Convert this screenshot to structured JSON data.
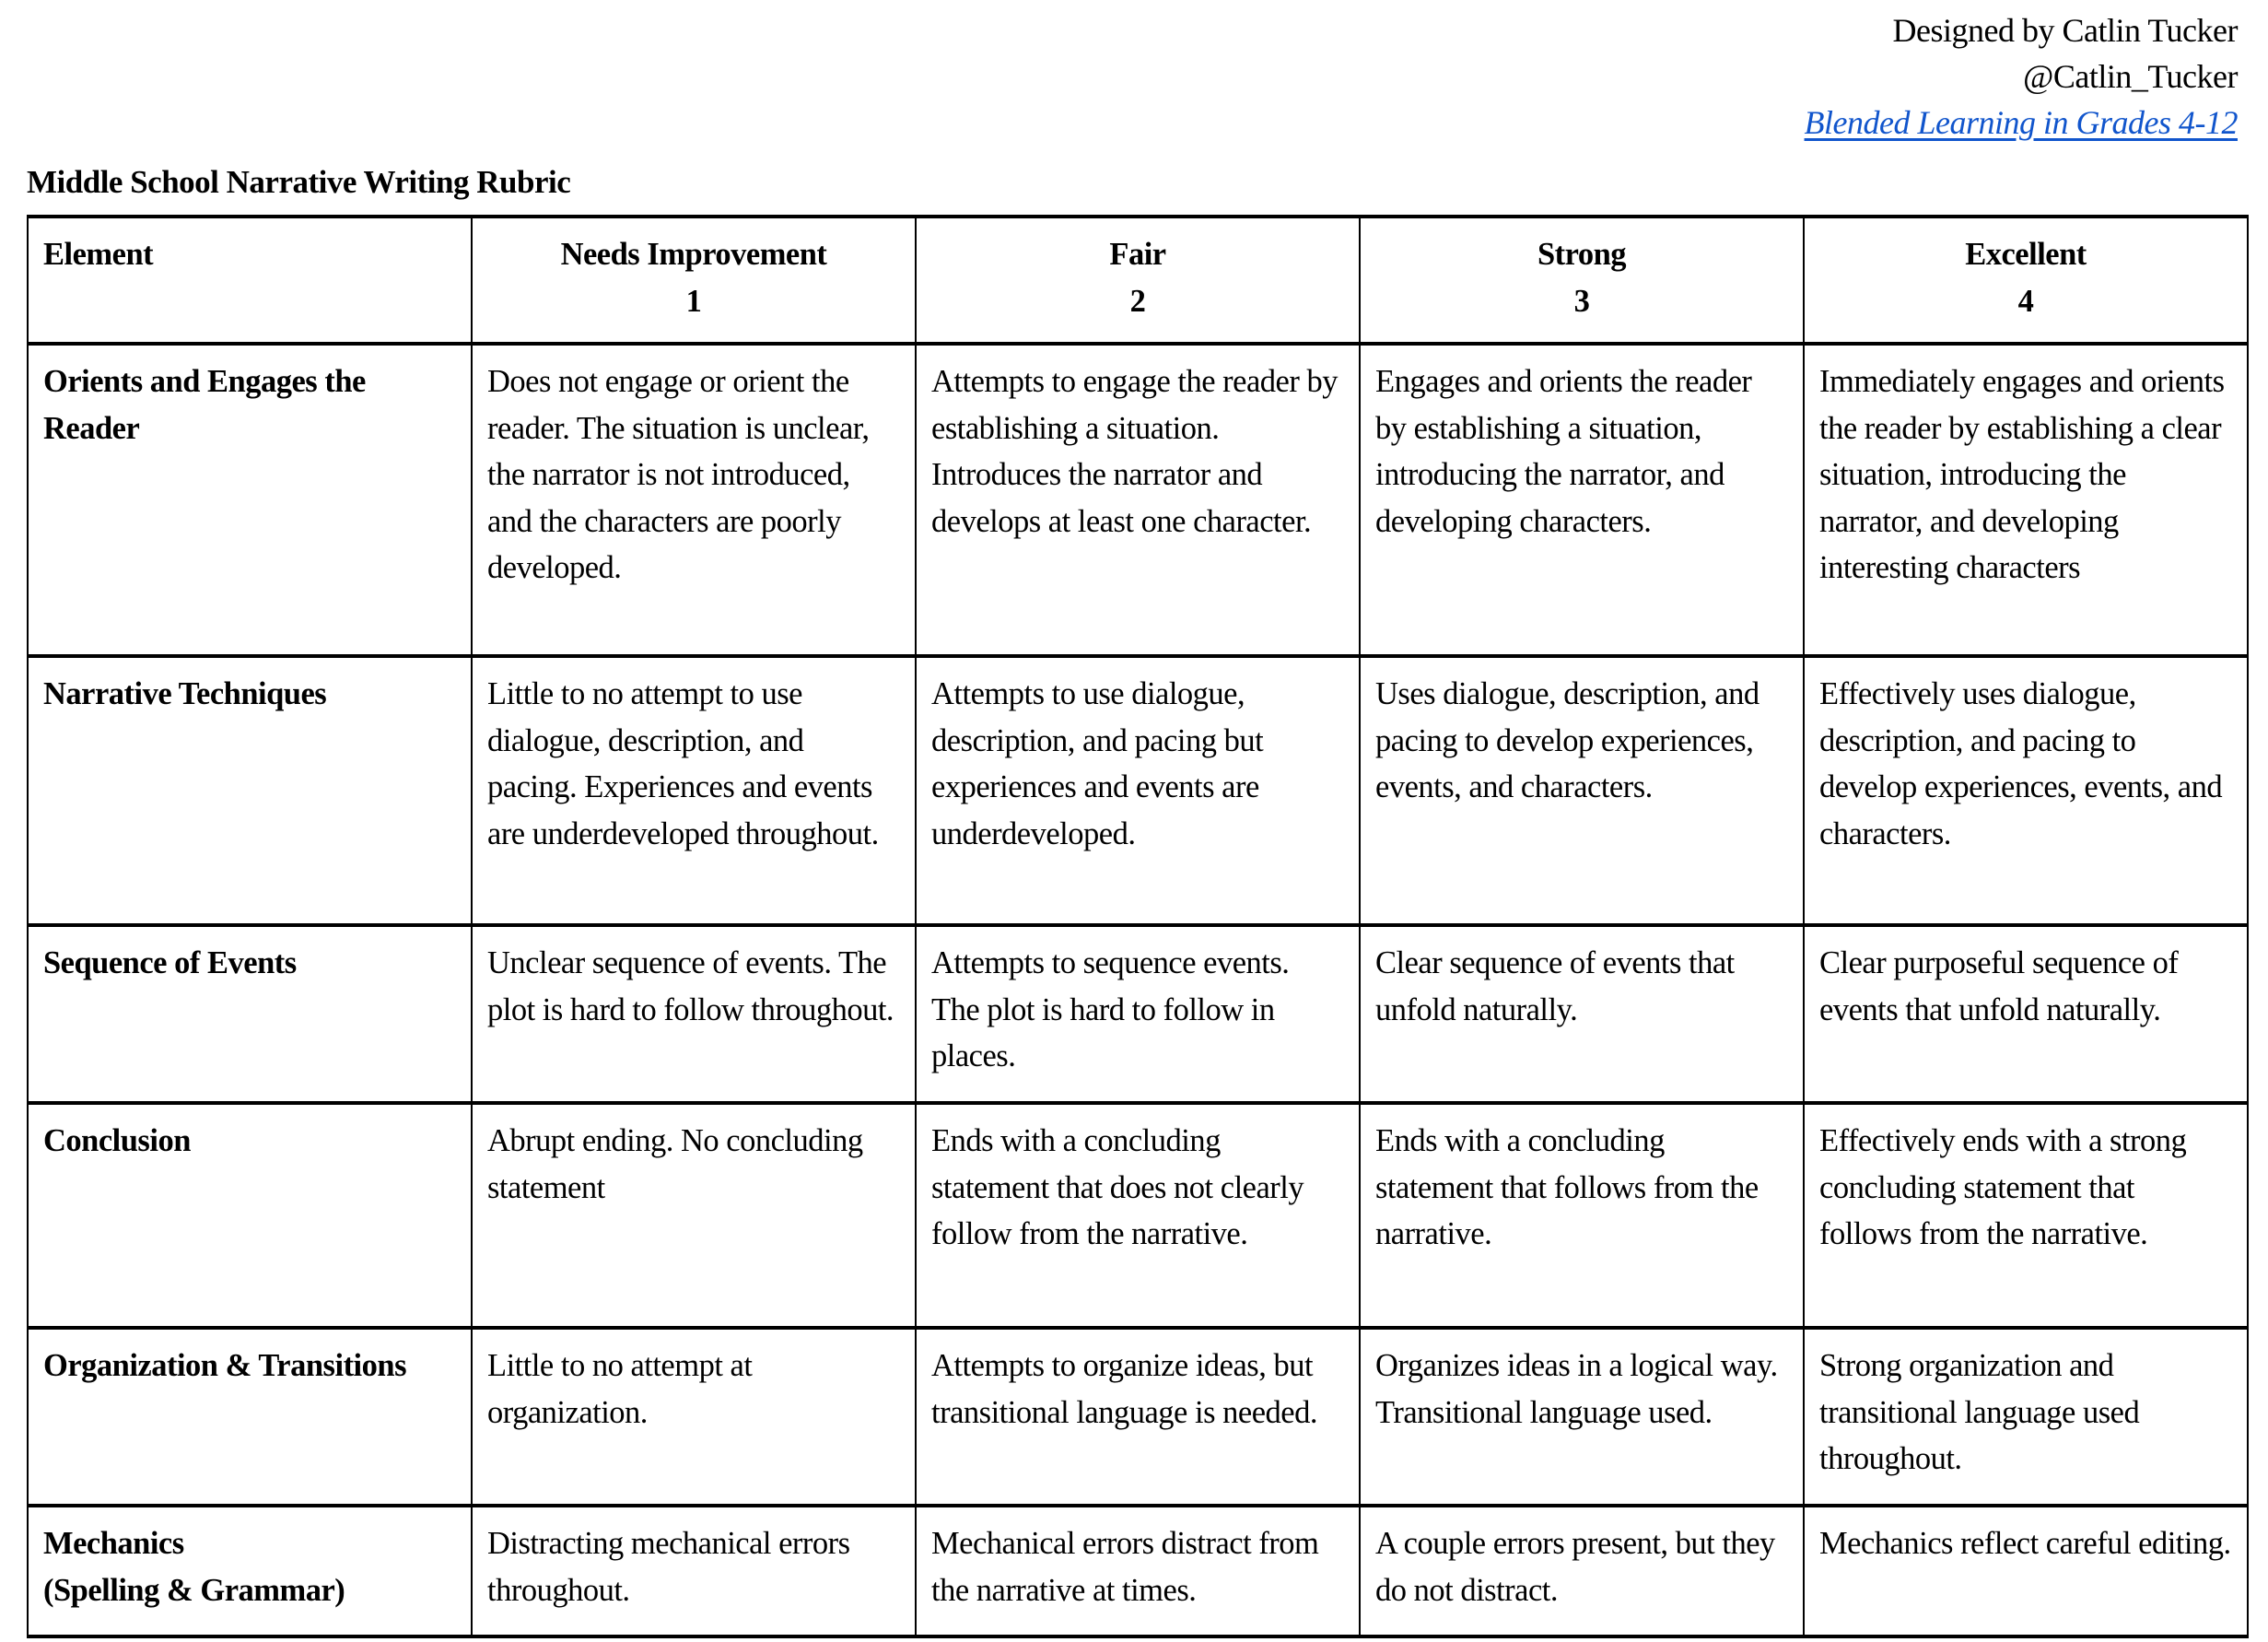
{
  "credits": {
    "designer": "Designed by Catlin Tucker",
    "handle": "@Catlin_Tucker",
    "book_link": "Blended Learning in Grades 4-12",
    "link_color": "#1155cc"
  },
  "rubric": {
    "title": "Middle School Narrative Writing Rubric",
    "columns": [
      {
        "label": "Element",
        "score": ""
      },
      {
        "label": "Needs Improvement",
        "score": "1"
      },
      {
        "label": "Fair",
        "score": "2"
      },
      {
        "label": "Strong",
        "score": "3"
      },
      {
        "label": "Excellent",
        "score": "4"
      }
    ],
    "rows": [
      {
        "element": "Orients and Engages the Reader",
        "cells": [
          "Does not engage or orient the reader. The situation is unclear, the narrator is not introduced, and the characters are poorly developed.",
          "Attempts to engage the reader by establishing a situation. Introduces the narrator and develops at least one character.",
          "Engages and orients the reader by establishing a situation, introducing the narrator, and developing characters.",
          "Immediately engages and orients the reader by establishing a clear situation, introducing the narrator, and developing interesting characters"
        ]
      },
      {
        "element": "Narrative Techniques",
        "cells": [
          "Little to no attempt to use dialogue, description, and pacing. Experiences and events are underdeveloped throughout.",
          "Attempts to use dialogue, description, and pacing but experiences and events are underdeveloped.",
          "Uses dialogue, description, and pacing to develop experiences, events, and characters.",
          "Effectively uses dialogue, description, and pacing to develop experiences, events, and characters."
        ]
      },
      {
        "element": "Sequence of Events",
        "cells": [
          "Unclear sequence of events. The plot is hard to follow throughout.",
          "Attempts to sequence events. The plot is hard to follow in places.",
          "Clear sequence of events that unfold naturally.",
          "Clear purposeful sequence of events that unfold naturally."
        ]
      },
      {
        "element": "Conclusion",
        "cells": [
          "Abrupt ending. No concluding statement",
          "Ends with a concluding statement that does not clearly follow from the narrative.",
          "Ends with a concluding statement that follows from the narrative.",
          "Effectively ends with a strong concluding statement that follows from the narrative."
        ]
      },
      {
        "element": "Organization & Transitions",
        "cells": [
          "Little to no attempt at organization.",
          "Attempts to organize ideas, but transitional language is needed.",
          "Organizes ideas in a logical way. Transitional language used.",
          "Strong organization and transitional language used throughout."
        ]
      },
      {
        "element_line1": "Mechanics",
        "element_line2": "(Spelling & Grammar)",
        "cells": [
          "Distracting mechanical errors throughout.",
          "Mechanical errors distract from the narrative at times.",
          "A couple errors present, but they do not distract.",
          "Mechanics reflect careful editing."
        ]
      }
    ]
  }
}
